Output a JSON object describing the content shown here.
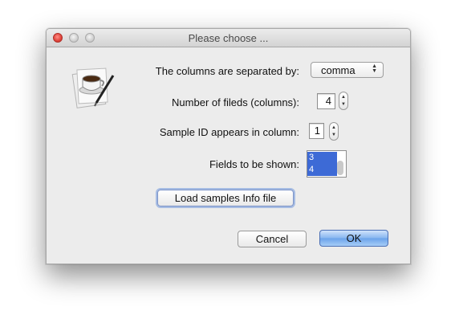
{
  "window": {
    "title": "Please choose ..."
  },
  "form": {
    "separator_label": "The columns are separated by:",
    "separator_value": "comma",
    "num_fields_label": "Number of fileds (columns):",
    "num_fields_value": "4",
    "sample_id_label": "Sample ID appears in column:",
    "sample_id_value": "1",
    "fields_shown_label": "Fields to be shown:",
    "fields_shown_items": [
      "3",
      "4"
    ]
  },
  "buttons": {
    "load_label": "Load samples Info file",
    "cancel_label": "Cancel",
    "ok_label": "OK"
  },
  "icons": {
    "app": "coffee-cup-pen-icon"
  },
  "colors": {
    "selection": "#3d6ad6",
    "default_button": "#86b6f0"
  }
}
